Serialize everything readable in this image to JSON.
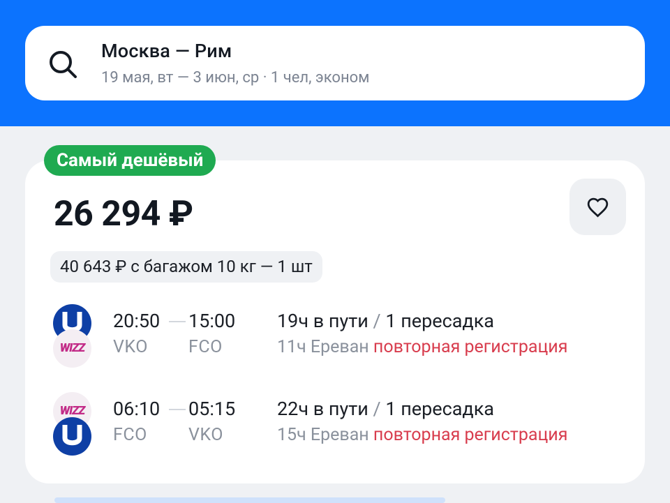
{
  "header": {
    "route": "Москва — Рим",
    "details": "19 мая, вт — 3 июн, ср · 1 чел, эконом"
  },
  "offer": {
    "badge": "Самый дешёвый",
    "price": "26 294 ₽",
    "baggage": "40 643 ₽ с багажом 10 кг — 1 шт",
    "segments": [
      {
        "depart_time": "20:50",
        "arrive_time": "15:00",
        "depart_code": "VKO",
        "arrive_code": "FCO",
        "duration": "19ч в пути",
        "slash": " / ",
        "transfers": "1 пересадка",
        "stopover": "11ч Ереван",
        "warning": "повторная регистрация",
        "airlines": [
          "UTair",
          "Wizz Air"
        ]
      },
      {
        "depart_time": "06:10",
        "arrive_time": "05:15",
        "depart_code": "FCO",
        "arrive_code": "VKO",
        "duration": "22ч в пути",
        "slash": " / ",
        "transfers": "1 пересадка",
        "stopover": "15ч Ереван",
        "warning": "повторная регистрация",
        "airlines": [
          "Wizz Air",
          "UTair"
        ]
      }
    ]
  },
  "logos": {
    "wizz_text": "WIZZ"
  },
  "colors": {
    "header_bg": "#0c73fe",
    "badge_bg": "#1faa51",
    "warning": "#d83c4d",
    "page_bg": "#eff1f4"
  },
  "icons": {
    "search": "search-icon",
    "favorite": "heart-icon"
  }
}
